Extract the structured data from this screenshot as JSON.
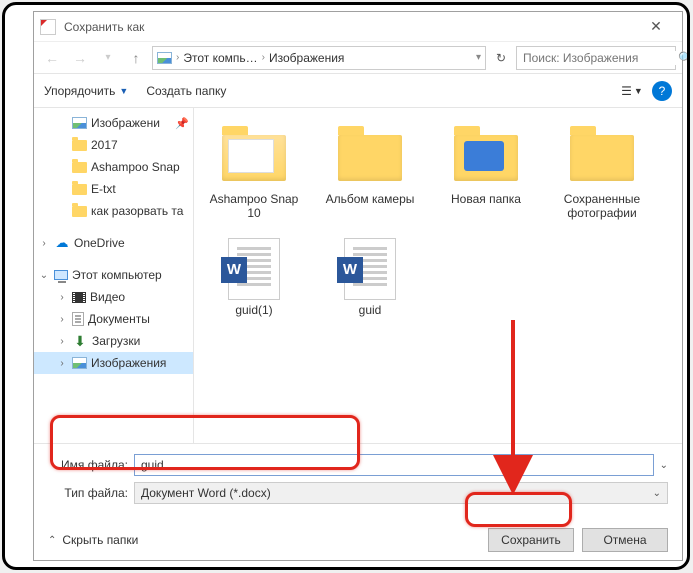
{
  "window": {
    "title": "Сохранить как",
    "close_glyph": "✕"
  },
  "nav": {
    "back": "←",
    "forward": "→",
    "up": "↑",
    "refresh": "↻",
    "dropdown": "▾"
  },
  "breadcrumbs": {
    "root_glyph": "▸",
    "c1": "Этот компь…",
    "c2": "Изображения",
    "sep": "›"
  },
  "search": {
    "placeholder": "Поиск: Изображения",
    "icon": "🔍"
  },
  "toolbar": {
    "organize": "Упорядочить",
    "new_folder": "Создать папку",
    "help": "?"
  },
  "sidebar": {
    "quick": [
      {
        "label": "Изображени",
        "icon": "pic",
        "pinned": true
      },
      {
        "label": "2017",
        "icon": "folder"
      },
      {
        "label": "Ashampoo Snap",
        "icon": "folder"
      },
      {
        "label": "E-txt",
        "icon": "folder"
      },
      {
        "label": "как разорвать та",
        "icon": "folder"
      }
    ],
    "onedrive": "OneDrive",
    "thispc": "Этот компьютер",
    "thispc_children": [
      {
        "label": "Видео",
        "icon": "video"
      },
      {
        "label": "Документы",
        "icon": "doc"
      },
      {
        "label": "Загрузки",
        "icon": "dl"
      },
      {
        "label": "Изображения",
        "icon": "pic",
        "selected": true
      }
    ]
  },
  "files": [
    {
      "label": "Ashampoo Snap 10",
      "type": "folder-open"
    },
    {
      "label": "Альбом камеры",
      "type": "folder"
    },
    {
      "label": "Новая папка",
      "type": "folder-camera"
    },
    {
      "label": "Сохраненные фотографии",
      "type": "folder"
    },
    {
      "label": "guid(1)",
      "type": "word"
    },
    {
      "label": "guid",
      "type": "word"
    }
  ],
  "fields": {
    "filename_label": "Имя файла:",
    "filename_value": "guid",
    "filetype_label": "Тип файла:",
    "filetype_value": "Документ Word (*.docx)"
  },
  "footer": {
    "hide_folders": "Скрыть папки",
    "save": "Сохранить",
    "cancel": "Отмена"
  }
}
